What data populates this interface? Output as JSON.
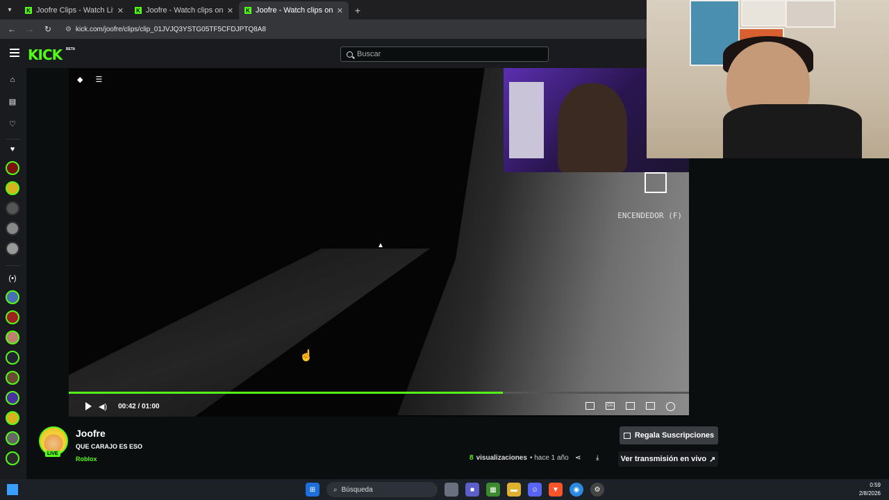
{
  "browser": {
    "tabs": [
      {
        "title": "Joofre Clips - Watch Live on Kick",
        "active": false
      },
      {
        "title": "Joofre - Watch clips on Kick",
        "active": false
      },
      {
        "title": "Joofre - Watch clips on Kick",
        "active": true
      }
    ],
    "url": "kick.com/joofre/clips/clip_01JVJQ3YSTG05TF5CFDJPTQ8A8"
  },
  "header": {
    "logo": "KICK",
    "logo_badge": "BETA",
    "search_placeholder": "Buscar"
  },
  "player": {
    "hud_label": "ENCENDEDOR (F)",
    "time_current": "00:42",
    "time_separator": "/",
    "time_total": "01:00",
    "progress_fraction": 0.7
  },
  "clip": {
    "channel": "Joofre",
    "live_badge": "LIVE",
    "title": "QUE CARAJO ES ESO",
    "category": "Roblox",
    "gift_button": "Regala Suscripciones",
    "views_count": "8",
    "views_label": "visualizaciones",
    "time_ago": "• hace 1 año",
    "live_link": "Ver transmisión en vivo"
  },
  "taskbar": {
    "search_label": "Búsqueda",
    "time": "0:59",
    "date": "2/8/2026"
  },
  "colors": {
    "accent": "#53fc18",
    "background": "#0b0e0f",
    "panel": "#191b1f"
  }
}
